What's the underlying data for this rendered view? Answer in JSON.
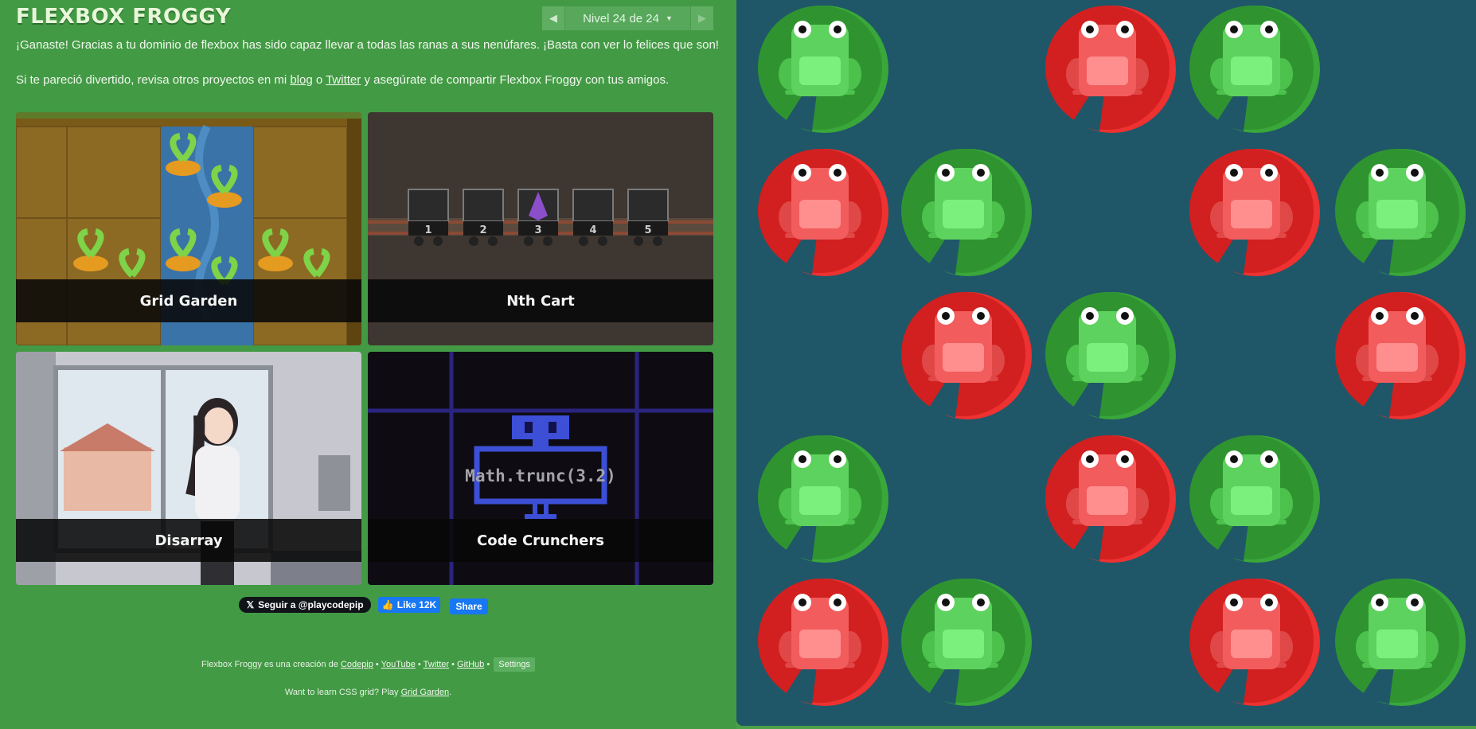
{
  "app": {
    "title": "FLEXBOX FROGGY"
  },
  "level_nav": {
    "prev_icon": "triangle-left-icon",
    "level_label": "Nivel 24 de 24",
    "dropdown_icon": "caret-down-icon",
    "next_icon": "triangle-right-icon"
  },
  "win_message": {
    "line1": "¡Ganaste! Gracias a tu dominio de flexbox has sido capaz llevar a todas las ranas a sus nenúfares. ¡Basta con ver lo felices que son!",
    "line2_before": "Si te pareció divertido, revisa otros proyectos en mi ",
    "blog_link": "blog",
    "line2_or": " o ",
    "twitter_link": "Twitter",
    "line2_after": " y asegúrate de compartir Flexbox Froggy con tus amigos."
  },
  "projects": [
    {
      "name": "Grid Garden"
    },
    {
      "name": "Nth Cart",
      "cart_numbers": [
        "1",
        "2",
        "3",
        "4",
        "5"
      ]
    },
    {
      "name": "Disarray"
    },
    {
      "name": "Code Crunchers",
      "code_text": "Math.trunc(3.2)"
    }
  ],
  "social": {
    "follow_label": "Seguir a @playcodepip",
    "like_label": "Like 12K",
    "share_label": "Share"
  },
  "footer": {
    "credit_text": "Flexbox Froggy es una creación de ",
    "links": [
      "Codepip",
      "YouTube",
      "Twitter",
      "GitHub"
    ],
    "separator": " • ",
    "settings_label": "Settings",
    "grid_text": "Want to learn CSS grid? Play ",
    "grid_link": "Grid Garden",
    "grid_end": "."
  },
  "board": {
    "frogs": [
      {
        "color": "green"
      },
      {
        "color": "red"
      },
      {
        "color": "green"
      },
      {
        "color": "red"
      },
      {
        "color": "green"
      },
      {
        "color": "red"
      },
      {
        "color": "green"
      },
      {
        "color": "red"
      },
      {
        "color": "green"
      },
      {
        "color": "red"
      },
      {
        "color": "green"
      },
      {
        "color": "red"
      },
      {
        "color": "green"
      },
      {
        "color": "red"
      },
      {
        "color": "green"
      },
      {
        "color": "red"
      },
      {
        "color": "green"
      }
    ],
    "lilypads": [
      {
        "color": "green"
      },
      {
        "color": "red"
      },
      {
        "color": "green"
      },
      {
        "color": "red"
      },
      {
        "color": "green"
      },
      {
        "color": "red"
      },
      {
        "color": "green"
      },
      {
        "color": "red"
      },
      {
        "color": "green"
      },
      {
        "color": "red"
      },
      {
        "color": "green"
      },
      {
        "color": "red"
      },
      {
        "color": "green"
      },
      {
        "color": "red"
      },
      {
        "color": "green"
      },
      {
        "color": "red"
      },
      {
        "color": "green"
      }
    ]
  },
  "colors": {
    "sidebar_bg": "#439a45",
    "board_bg": "#1f5768",
    "green_pad": "#2f9430",
    "red_pad": "#d21f1f",
    "green_frog": "#5ed25e",
    "red_frog": "#f25c5c"
  }
}
